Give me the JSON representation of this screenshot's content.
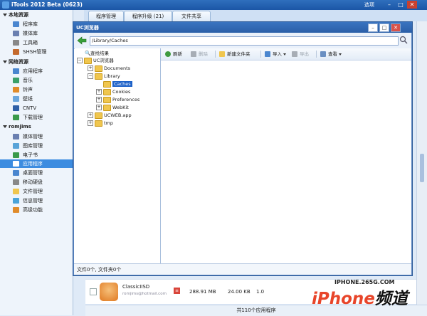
{
  "window": {
    "title": "iTools 2012 Beta (0623)",
    "options": "选项"
  },
  "tabs": [
    "程序管理",
    "程序升级 (21)",
    "文件共享"
  ],
  "sidebar": {
    "local": {
      "header": "本地资源",
      "items": [
        "程序库",
        "媒体库",
        "工具箱",
        "SHSH管理"
      ]
    },
    "network": {
      "header": "网络资源",
      "items": [
        "应用程序",
        "音乐",
        "铃声",
        "壁纸",
        "CNTV",
        "下载管理"
      ]
    },
    "device": {
      "header": "romjims",
      "items": [
        "媒体管理",
        "图库管理",
        "电子书",
        "应用程序",
        "桌面管理",
        "移动硬盘",
        "文件管理",
        "信息管理",
        "高级功能"
      ]
    }
  },
  "dialog": {
    "title": "UC浏览器",
    "path": "/Library/Caches",
    "status": "文件0个, 文件夹0个",
    "toolbar": [
      "刷新",
      "删除",
      "新建文件夹",
      "导入",
      "导出",
      "查看"
    ],
    "tree": {
      "search": "查找结果",
      "root": "UC浏览器",
      "nodes": [
        "Documents",
        "Library",
        "Caches",
        "Cookies",
        "Preferences",
        "WebKit",
        "UCWEB.app",
        "tmp"
      ]
    }
  },
  "app_row": {
    "name": "ClassicIISD",
    "email": "romjims@hotmail.com",
    "size": "288.91 MB",
    "data": "24.00 KB",
    "version": "1.0"
  },
  "footer": {
    "count": "共110个应用程序"
  },
  "watermark": {
    "site": "IPHONE.265G.COM",
    "brand_a": "iPhone",
    "brand_b": "频道"
  },
  "colors": {
    "titlebar": "#1b56a6",
    "accent": "#3c8ce0",
    "folder": "#f0c64e"
  }
}
